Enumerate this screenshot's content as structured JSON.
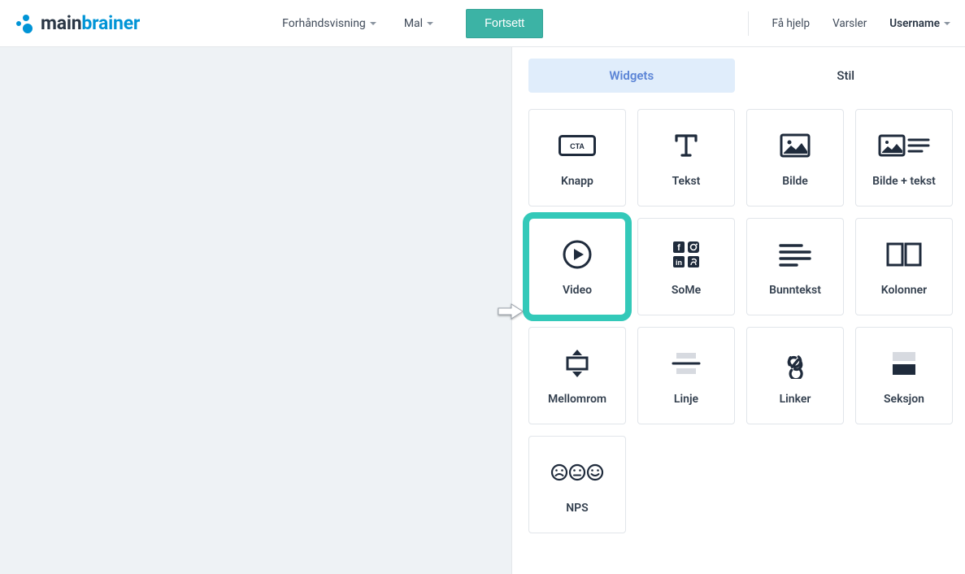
{
  "logo": {
    "part1": "main",
    "part2": "brainer"
  },
  "nav": {
    "preview": "Forhåndsvisning",
    "template": "Mal",
    "continue": "Fortsett"
  },
  "topRight": {
    "help": "Få hjelp",
    "notifications": "Varsler",
    "username": "Username"
  },
  "tabs": {
    "widgets": "Widgets",
    "style": "Stil"
  },
  "widgets": {
    "button": "Knapp",
    "text": "Tekst",
    "image": "Bilde",
    "imageText": "Bilde + tekst",
    "video": "Video",
    "some": "SoMe",
    "footer": "Bunntekst",
    "columns": "Kolonner",
    "spacing": "Mellomrom",
    "line": "Linje",
    "links": "Linker",
    "section": "Seksjon",
    "nps": "NPS"
  }
}
